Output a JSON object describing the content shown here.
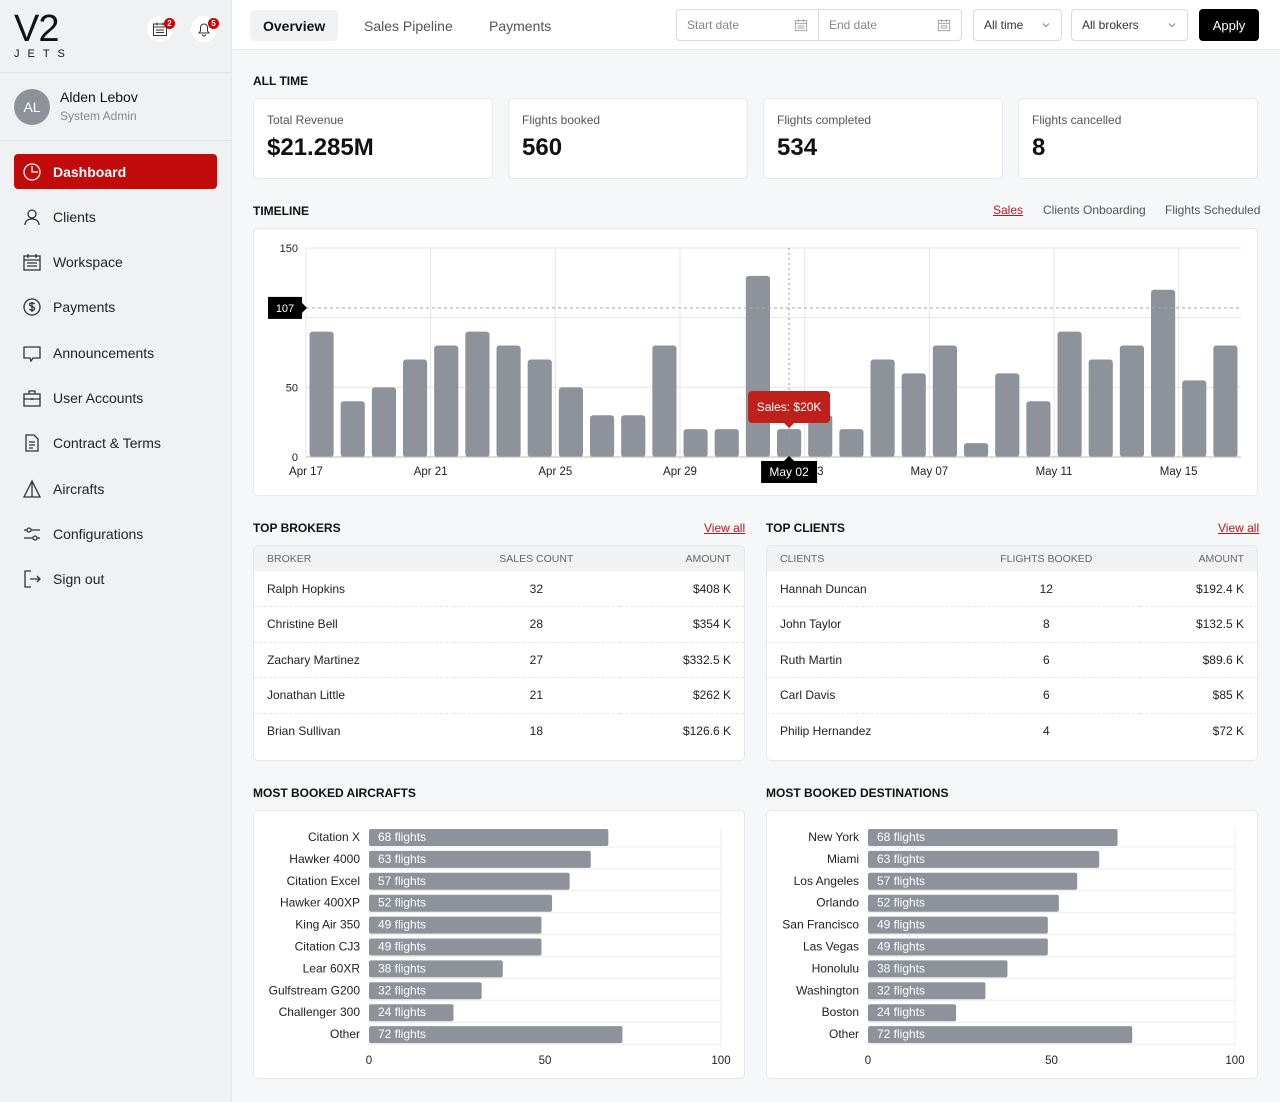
{
  "brand": {
    "logo_main": "V2",
    "logo_sub": "JETS"
  },
  "notifications": {
    "calendar_count": "2",
    "bell_count": "5"
  },
  "user": {
    "initials": "AL",
    "name": "Alden Lebov",
    "role": "System Admin"
  },
  "sidebar": {
    "items": [
      {
        "label": "Dashboard",
        "icon": "dashboard-icon",
        "active": true
      },
      {
        "label": "Clients",
        "icon": "user-icon"
      },
      {
        "label": "Workspace",
        "icon": "calendar-icon"
      },
      {
        "label": "Payments",
        "icon": "dollar-icon"
      },
      {
        "label": "Announcements",
        "icon": "chat-icon"
      },
      {
        "label": "User Accounts",
        "icon": "briefcase-icon"
      },
      {
        "label": "Contract & Terms",
        "icon": "document-icon"
      },
      {
        "label": "Aircrafts",
        "icon": "plane-icon"
      },
      {
        "label": "Configurations",
        "icon": "sliders-icon"
      },
      {
        "label": "Sign out",
        "icon": "sign-out-icon"
      }
    ]
  },
  "header": {
    "tabs": [
      {
        "label": "Overview",
        "active": true
      },
      {
        "label": "Sales Pipeline"
      },
      {
        "label": "Payments"
      }
    ],
    "start_date_placeholder": "Start date",
    "end_date_placeholder": "End date",
    "range": "All time",
    "broker": "All brokers",
    "apply": "Apply"
  },
  "colors": {
    "accent": "#c20a0a",
    "bar": "#8e939b"
  },
  "all_time": {
    "title": "ALL TIME",
    "stats": [
      {
        "label": "Total Revenue",
        "value": "$21.285M"
      },
      {
        "label": "Flights booked",
        "value": "560"
      },
      {
        "label": "Flights completed",
        "value": "534"
      },
      {
        "label": "Flights cancelled",
        "value": "8"
      }
    ]
  },
  "timeline": {
    "title": "TIMELINE",
    "tabs": [
      {
        "label": "Sales",
        "active": true
      },
      {
        "label": "Clients Onboarding"
      },
      {
        "label": "Flights Scheduled"
      }
    ]
  },
  "top_brokers": {
    "title": "TOP BROKERS",
    "view_all": "View all",
    "columns": [
      "BROKER",
      "SALES COUNT",
      "AMOUNT"
    ],
    "rows": [
      [
        "Ralph Hopkins",
        "32",
        "$408 K"
      ],
      [
        "Christine Bell",
        "28",
        "$354 K"
      ],
      [
        "Zachary Martinez",
        "27",
        "$332.5 K"
      ],
      [
        "Jonathan Little",
        "21",
        "$262 K"
      ],
      [
        "Brian Sullivan",
        "18",
        "$126.6 K"
      ]
    ]
  },
  "top_clients": {
    "title": "TOP CLIENTS",
    "view_all": "View all",
    "columns": [
      "CLIENTS",
      "FLIGHTS BOOKED",
      "AMOUNT"
    ],
    "rows": [
      [
        "Hannah Duncan",
        "12",
        "$192.4 K"
      ],
      [
        "John Taylor",
        "8",
        "$132.5 K"
      ],
      [
        "Ruth Martin",
        "6",
        "$89.6 K"
      ],
      [
        "Carl Davis",
        "6",
        "$85 K"
      ],
      [
        "Philip Hernandez",
        "4",
        "$72 K"
      ]
    ]
  },
  "aircrafts_title": "MOST BOOKED AIRCRAFTS",
  "destinations_title": "MOST BOOKED DESTINATIONS",
  "chart_data": [
    {
      "type": "bar",
      "ylim": [
        0,
        150
      ],
      "yticks": [
        0,
        50,
        150
      ],
      "grid": true,
      "categories": [
        "Apr 17",
        "Apr 18",
        "Apr 19",
        "Apr 20",
        "Apr 21",
        "Apr 22",
        "Apr 23",
        "Apr 24",
        "Apr 25",
        "Apr 26",
        "Apr 27",
        "Apr 28",
        "Apr 29",
        "Apr 30",
        "May 01",
        "May 02",
        "May 03",
        "May 04",
        "May 05",
        "May 06",
        "May 07",
        "May 08",
        "May 09",
        "May 10",
        "May 11",
        "May 12",
        "May 13",
        "May 14",
        "May 15",
        "May 16"
      ],
      "xtick_labels": [
        "Apr 17",
        "Apr 21",
        "Apr 25",
        "Apr 29",
        "May 03",
        "May 07",
        "May 11",
        "May 15"
      ],
      "values": [
        90,
        40,
        50,
        70,
        80,
        90,
        80,
        70,
        50,
        30,
        30,
        80,
        20,
        20,
        130,
        20,
        30,
        20,
        70,
        60,
        80,
        10,
        60,
        40,
        90,
        70,
        80,
        120,
        55,
        80
      ],
      "reference_line": {
        "value": 107,
        "label": "107"
      },
      "tooltip": {
        "category": "May 02",
        "x_label": "May 02",
        "text": "Sales: $20K"
      }
    },
    {
      "type": "bar",
      "orientation": "horizontal",
      "xlim": [
        0,
        100
      ],
      "xticks": [
        "0",
        "50",
        "100"
      ],
      "categories": [
        "Citation X",
        "Hawker 4000",
        "Citation Excel",
        "Hawker 400XP",
        "King Air 350",
        "Citation CJ3",
        "Lear 60XR",
        "Gulfstream G200",
        "Challenger 300",
        "Other"
      ],
      "values": [
        68,
        63,
        57,
        52,
        49,
        49,
        38,
        32,
        24,
        72
      ],
      "labels": [
        "68 flights",
        "63 flights",
        "57 flights",
        "52 flights",
        "49 flights",
        "49 flights",
        "38 flights",
        "32 flights",
        "24 flights",
        "72 flights"
      ]
    },
    {
      "type": "bar",
      "orientation": "horizontal",
      "xlim": [
        0,
        100
      ],
      "xticks": [
        "0",
        "50",
        "100"
      ],
      "categories": [
        "New York",
        "Miami",
        "Los Angeles",
        "Orlando",
        "San Francisco",
        "Las Vegas",
        "Honolulu",
        "Washington",
        "Boston",
        "Other"
      ],
      "values": [
        68,
        63,
        57,
        52,
        49,
        49,
        38,
        32,
        24,
        72
      ],
      "labels": [
        "68 flights",
        "63 flights",
        "57 flights",
        "52 flights",
        "49 flights",
        "49 flights",
        "38 flights",
        "32 flights",
        "24 flights",
        "72 flights"
      ]
    }
  ]
}
